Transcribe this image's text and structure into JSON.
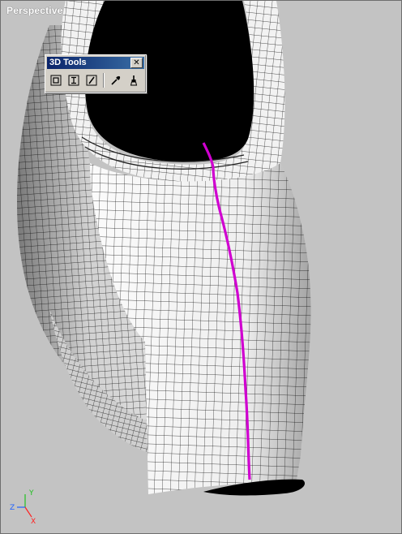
{
  "viewport": {
    "label": "Perspective",
    "background": "#c3c3c3"
  },
  "model": {
    "seam_color": "#d000d0",
    "mesh_color": "#1a1a1a",
    "surface_color": "#e8e8e8"
  },
  "toolbar": {
    "title": "3D Tools",
    "close_glyph": "✕",
    "buttons": [
      {
        "icon": "select-faces-icon"
      },
      {
        "icon": "text-cursor-icon"
      },
      {
        "icon": "edit-pencil-icon"
      },
      {
        "icon": "eyedropper-icon"
      },
      {
        "icon": "paint-brush-icon"
      }
    ]
  },
  "axis": {
    "x_label": "X",
    "y_label": "Y",
    "z_label": "Z",
    "x_color": "#ff2020",
    "y_color": "#20c020",
    "z_color": "#2060ff"
  }
}
